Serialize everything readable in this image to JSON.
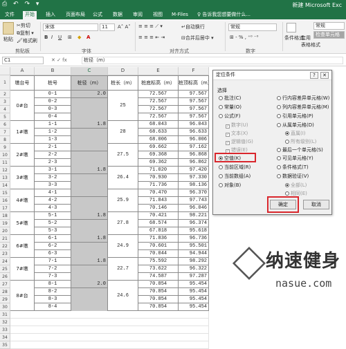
{
  "app": {
    "title": "新建 Microsoft Exc",
    "quick_access": "⎙ ↶ ↷ ▾"
  },
  "tabs": [
    {
      "label": "文件"
    },
    {
      "label": "开始"
    },
    {
      "label": "插入"
    },
    {
      "label": "页面布局"
    },
    {
      "label": "公式"
    },
    {
      "label": "数据"
    },
    {
      "label": "审阅"
    },
    {
      "label": "视图"
    },
    {
      "label": "M-Files"
    },
    {
      "label": "♀ 告诉我您想要做什么..."
    }
  ],
  "ribbon": {
    "paste": "粘贴",
    "cut": "剪切",
    "copy": "复制 ▾",
    "format_painter": "格式刷",
    "font_name": "宋体",
    "font_size": "11",
    "wrap": "自动换行",
    "merge": "合并后居中 ▾",
    "number_format": "常规",
    "cond_format": "条件格式",
    "table_format": "套用\n表格格式",
    "style_normal": "常规",
    "style_check": "检查单元格",
    "groups": {
      "clipboard": "剪贴板",
      "font": "字体",
      "alignment": "对齐方式",
      "number": "数字"
    }
  },
  "formula_bar": {
    "name_box": "C1",
    "icons": "✕ ✓ fx",
    "value": "桩径（m）"
  },
  "columns": [
    "A",
    "B",
    "C",
    "D",
    "E",
    "F"
  ],
  "headers": {
    "A": "墩台号",
    "B": "桩号",
    "C": "桩径（m）",
    "D": "桩长（m）",
    "E": "桩底标高（m）",
    "F": "桩顶标高（m）"
  },
  "row_numbers": [
    "1",
    "2",
    "3",
    "4",
    "5",
    "6",
    "7",
    "8",
    "9",
    "10",
    "11",
    "12",
    "13",
    "14",
    "15",
    "16",
    "17",
    "18",
    "19",
    "20",
    "21",
    "22",
    "23",
    "24",
    "25",
    "26",
    "27",
    "28",
    "29",
    "30",
    "31",
    "32",
    "33",
    "34",
    "35"
  ],
  "groups": [
    {
      "pier": "0#台",
      "dia": "2.0",
      "len": "25"
    },
    {
      "pier": "1#墩",
      "dia": "1.8",
      "len": "28"
    },
    {
      "pier": "2#墩",
      "dia": "",
      "len": "27.5"
    },
    {
      "pier": "3#墩",
      "dia": "1.8",
      "len": "26.4"
    },
    {
      "pier": "4#墩",
      "dia": "",
      "len": "25.9"
    },
    {
      "pier": "5#墩",
      "dia": "1.8",
      "len": "27.8"
    },
    {
      "pier": "6#墩",
      "dia": "1.8",
      "len": "24.9"
    },
    {
      "pier": "7#墩",
      "dia": "1.8",
      "len": "22.7"
    },
    {
      "pier": "8#台",
      "dia": "2.0",
      "len": "24.6"
    }
  ],
  "rows": [
    {
      "pile": "0-1",
      "bot": "72.567",
      "top": "97.567"
    },
    {
      "pile": "0-2",
      "bot": "72.567",
      "top": "97.567"
    },
    {
      "pile": "0-3",
      "bot": "72.567",
      "top": "97.567"
    },
    {
      "pile": "0-4",
      "bot": "72.567",
      "top": "97.567"
    },
    {
      "pile": "1-1",
      "bot": "68.043",
      "top": "96.043"
    },
    {
      "pile": "1-2",
      "bot": "68.633",
      "top": "96.633"
    },
    {
      "pile": "1-3",
      "bot": "68.006",
      "top": "96.006"
    },
    {
      "pile": "2-1",
      "bot": "69.662",
      "top": "97.162"
    },
    {
      "pile": "2-2",
      "bot": "69.368",
      "top": "96.868"
    },
    {
      "pile": "2-3",
      "bot": "69.362",
      "top": "96.862"
    },
    {
      "pile": "3-1",
      "bot": "71.020",
      "top": "97.420"
    },
    {
      "pile": "3-2",
      "bot": "70.930",
      "top": "97.330"
    },
    {
      "pile": "3-3",
      "bot": "71.736",
      "top": "98.136"
    },
    {
      "pile": "4-1",
      "bot": "70.470",
      "top": "96.370"
    },
    {
      "pile": "4-2",
      "bot": "71.843",
      "top": "97.743"
    },
    {
      "pile": "4-3",
      "bot": "70.146",
      "top": "96.046"
    },
    {
      "pile": "5-1",
      "bot": "70.421",
      "top": "98.221"
    },
    {
      "pile": "5-2",
      "bot": "68.574",
      "top": "96.374"
    },
    {
      "pile": "5-3",
      "bot": "67.818",
      "top": "95.618"
    },
    {
      "pile": "6-1",
      "bot": "71.836",
      "top": "96.736"
    },
    {
      "pile": "6-2",
      "bot": "70.601",
      "top": "95.501"
    },
    {
      "pile": "6-3",
      "bot": "70.044",
      "top": "94.944"
    },
    {
      "pile": "7-1",
      "bot": "75.592",
      "top": "98.292"
    },
    {
      "pile": "7-2",
      "bot": "73.622",
      "top": "96.322"
    },
    {
      "pile": "7-3",
      "bot": "74.587",
      "top": "97.287"
    },
    {
      "pile": "8-1",
      "bot": "70.854",
      "top": "95.454"
    },
    {
      "pile": "8-2",
      "bot": "70.854",
      "top": "95.454"
    },
    {
      "pile": "8-3",
      "bot": "70.854",
      "top": "95.454"
    },
    {
      "pile": "8-4",
      "bot": "70.854",
      "top": "95.454"
    }
  ],
  "dialog": {
    "title": "定位条件",
    "help": "?",
    "close": "✕",
    "section": "选择",
    "left_options": [
      "批注(C)",
      "常量(O)",
      "公式(F)",
      "数字(U)",
      "文本(X)",
      "逻辑值(G)",
      "错误(E)",
      "空值(K)",
      "当前区域(R)",
      "当前数组(A)",
      "对象(B)"
    ],
    "right_options": [
      "行内容差异单元格(W)",
      "列内容差异单元格(M)",
      "引用单元格(P)",
      "从属单元格(D)",
      "直属(I)",
      "所有级别(L)",
      "最后一个单元格(S)",
      "可见单元格(Y)",
      "条件格式(T)",
      "数据验证(V)",
      "全部(L)",
      "相同(E)"
    ],
    "ok": "确定",
    "cancel": "取消"
  },
  "watermark": {
    "brand": "纳速健身",
    "url": "nasue.com"
  }
}
